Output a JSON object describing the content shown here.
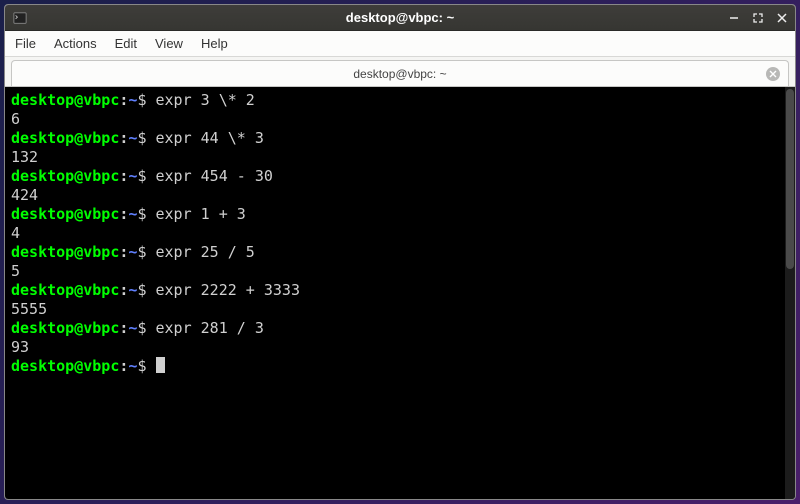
{
  "window": {
    "title": "desktop@vbpc: ~"
  },
  "menubar": {
    "items": [
      "File",
      "Actions",
      "Edit",
      "View",
      "Help"
    ]
  },
  "tab": {
    "label": "desktop@vbpc: ~"
  },
  "prompt": {
    "user_host": "desktop@vbpc",
    "sep": ":",
    "path": "~",
    "symbol": "$"
  },
  "session": [
    {
      "cmd": "expr 3 \\* 2",
      "out": "6"
    },
    {
      "cmd": "expr 44 \\* 3",
      "out": "132"
    },
    {
      "cmd": "expr 454 - 30",
      "out": "424"
    },
    {
      "cmd": "expr 1 + 3",
      "out": "4"
    },
    {
      "cmd": "expr 25 / 5",
      "out": "5"
    },
    {
      "cmd": "expr 2222 + 3333",
      "out": "5555"
    },
    {
      "cmd": "expr 281 / 3",
      "out": "93"
    }
  ]
}
